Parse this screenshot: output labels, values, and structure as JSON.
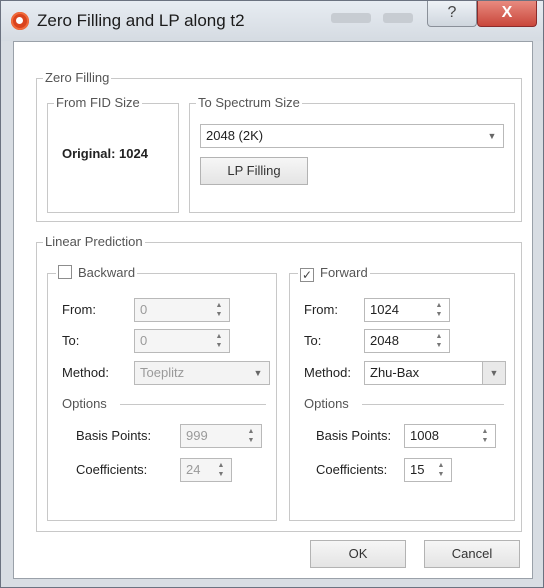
{
  "window": {
    "title": "Zero Filling and LP along t2",
    "help_glyph": "?",
    "close_glyph": "X"
  },
  "zero_filling": {
    "legend": "Zero Filling",
    "from_fid": {
      "legend": "From FID Size",
      "value": "Original: 1024"
    },
    "to_spectrum": {
      "legend": "To Spectrum Size",
      "selected": "2048 (2K)",
      "lp_button": "LP Filling"
    }
  },
  "linear_prediction": {
    "legend": "Linear Prediction",
    "backward": {
      "label": "Backward",
      "checked": false,
      "check_glyph": "",
      "from_label": "From:",
      "from_value": "0",
      "to_label": "To:",
      "to_value": "0",
      "method_label": "Method:",
      "method_value": "Toeplitz",
      "options_label": "Options",
      "basis_label": "Basis Points:",
      "basis_value": "999",
      "coeff_label": "Coefficients:",
      "coeff_value": "24"
    },
    "forward": {
      "label": "Forward",
      "checked": true,
      "check_glyph": "✓",
      "from_label": "From:",
      "from_value": "1024",
      "to_label": "To:",
      "to_value": "2048",
      "method_label": "Method:",
      "method_value": "Zhu-Bax",
      "options_label": "Options",
      "basis_label": "Basis Points:",
      "basis_value": "1008",
      "coeff_label": "Coefficients:",
      "coeff_value": "15"
    }
  },
  "footer": {
    "ok": "OK",
    "cancel": "Cancel"
  },
  "spin_glyphs": {
    "up": "▲",
    "down": "▼"
  },
  "combo_glyph": "▼"
}
